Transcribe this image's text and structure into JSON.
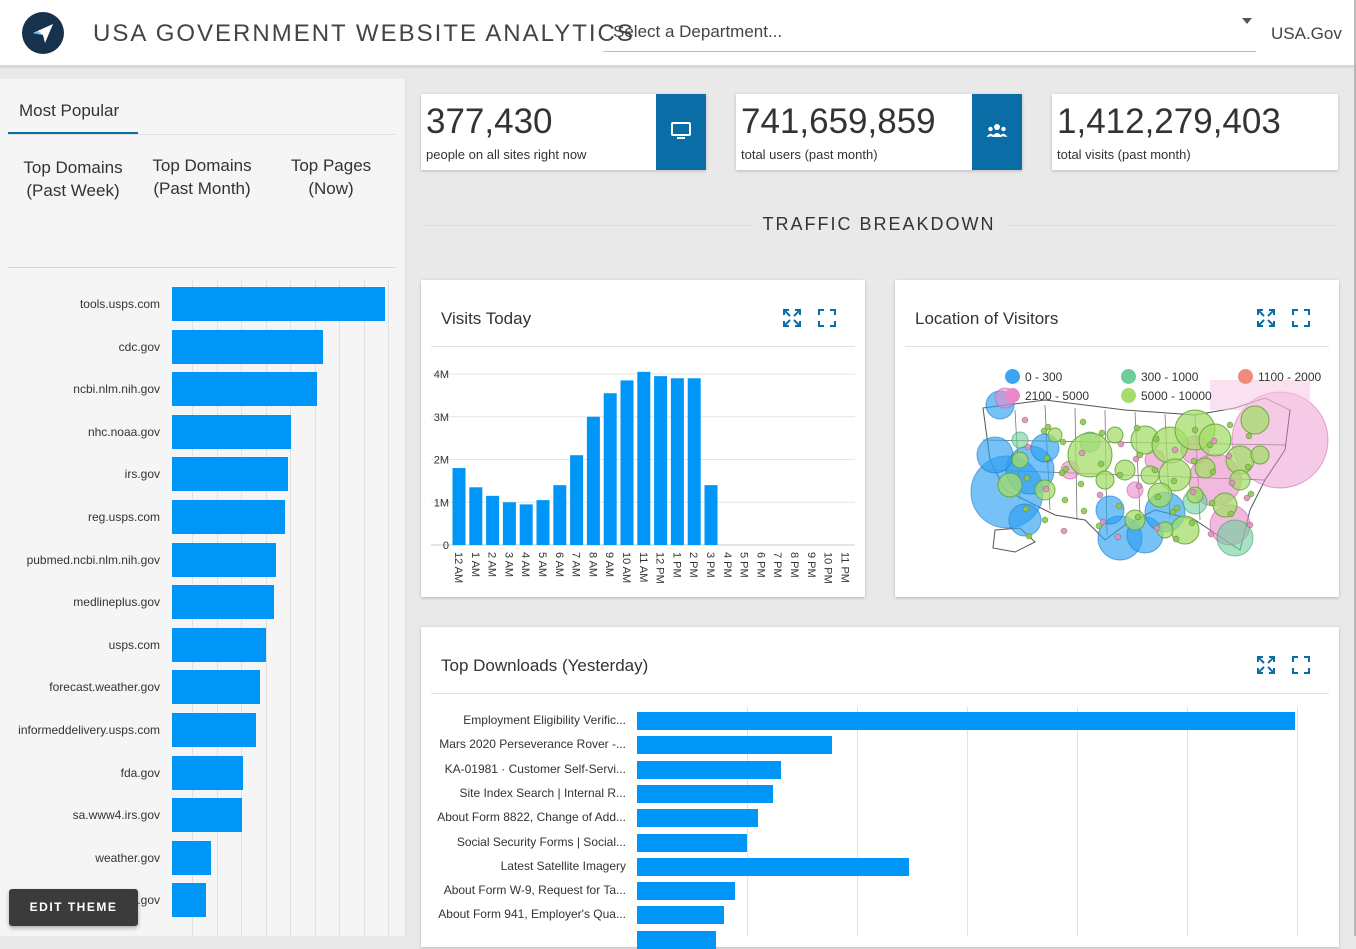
{
  "header": {
    "title": "USA GOVERNMENT WEBSITE ANALYTICS",
    "department_select": "Select a Department...",
    "site_link": "USA.Gov"
  },
  "sidebar": {
    "tab": "Most Popular",
    "options": [
      {
        "label": "Top Domains (Past Week)"
      },
      {
        "label": "Top Domains (Past Month)"
      },
      {
        "label": "Top Pages (Now)"
      }
    ],
    "domains": [
      {
        "name": "tools.usps.com",
        "value": 1.0
      },
      {
        "name": "cdc.gov",
        "value": 0.71
      },
      {
        "name": "ncbi.nlm.nih.gov",
        "value": 0.68
      },
      {
        "name": "nhc.noaa.gov",
        "value": 0.56
      },
      {
        "name": "irs.gov",
        "value": 0.545
      },
      {
        "name": "reg.usps.com",
        "value": 0.53
      },
      {
        "name": "pubmed.ncbi.nlm.nih.gov",
        "value": 0.49
      },
      {
        "name": "medlineplus.gov",
        "value": 0.48
      },
      {
        "name": "usps.com",
        "value": 0.44
      },
      {
        "name": "forecast.weather.gov",
        "value": 0.415
      },
      {
        "name": "informeddelivery.usps.com",
        "value": 0.395
      },
      {
        "name": "fda.gov",
        "value": 0.335
      },
      {
        "name": "sa.www4.irs.gov",
        "value": 0.33
      },
      {
        "name": "weather.gov",
        "value": 0.185
      },
      {
        "name": ".gov",
        "value": 0.16
      }
    ],
    "edit_theme": "EDIT THEME"
  },
  "stats": [
    {
      "value": "377,430",
      "label": "people on all sites right now",
      "icon": "monitor-icon"
    },
    {
      "value": "741,659,859",
      "label": "total users (past month)",
      "icon": "users-icon"
    },
    {
      "value": "1,412,279,403",
      "label": "total visits (past month)",
      "icon": ""
    }
  ],
  "section_title": "TRAFFIC BREAKDOWN",
  "visits_card": {
    "title": "Visits Today"
  },
  "location_card": {
    "title": "Location of Visitors",
    "legend": [
      {
        "label": "0 - 300",
        "color": "#3da5f0"
      },
      {
        "label": "300 - 1000",
        "color": "#6ccf9a"
      },
      {
        "label": "1100 - 2000",
        "color": "#f08a7a"
      },
      {
        "label": "2100 - 5000",
        "color": "#e88ac8"
      },
      {
        "label": "5000 - 10000",
        "color": "#a6dc6a"
      }
    ]
  },
  "downloads_card": {
    "title": "Top Downloads (Yesterday)",
    "items": [
      {
        "label": "Employment Eligibility Verific...",
        "value": 1.0
      },
      {
        "label": "Mars 2020 Perseverance Rover -...",
        "value": 0.296
      },
      {
        "label": "KA-01981 · Customer Self-Servi...",
        "value": 0.219
      },
      {
        "label": "Site Index Search | Internal R...",
        "value": 0.207
      },
      {
        "label": "About Form 8822, Change of Add...",
        "value": 0.184
      },
      {
        "label": "Social Security Forms | Social...",
        "value": 0.167
      },
      {
        "label": "Latest Satellite Imagery",
        "value": 0.414
      },
      {
        "label": "About Form W-9, Request for Ta...",
        "value": 0.149
      },
      {
        "label": "About Form 941, Employer's Qua...",
        "value": 0.132
      },
      {
        "label": "",
        "value": 0.12
      }
    ]
  },
  "chart_data": {
    "type": "bar",
    "title": "Visits Today",
    "categories": [
      "12 AM",
      "1 AM",
      "2 AM",
      "3 AM",
      "4 AM",
      "5 AM",
      "6 AM",
      "7 AM",
      "8 AM",
      "9 AM",
      "10 AM",
      "11 AM",
      "12 PM",
      "1 PM",
      "2 PM",
      "3 PM",
      "4 PM",
      "5 PM",
      "6 PM",
      "7 PM",
      "8 PM",
      "9 PM",
      "10 PM",
      "11 PM"
    ],
    "values": [
      1800000,
      1350000,
      1150000,
      1000000,
      950000,
      1050000,
      1400000,
      2100000,
      3000000,
      3550000,
      3850000,
      4050000,
      3950000,
      3900000,
      3900000,
      1400000,
      0,
      0,
      0,
      0,
      0,
      0,
      0,
      0
    ],
    "yticks": [
      "0",
      "1M",
      "2M",
      "3M",
      "4M"
    ],
    "ylim": [
      0,
      4000000
    ],
    "grid": true
  }
}
